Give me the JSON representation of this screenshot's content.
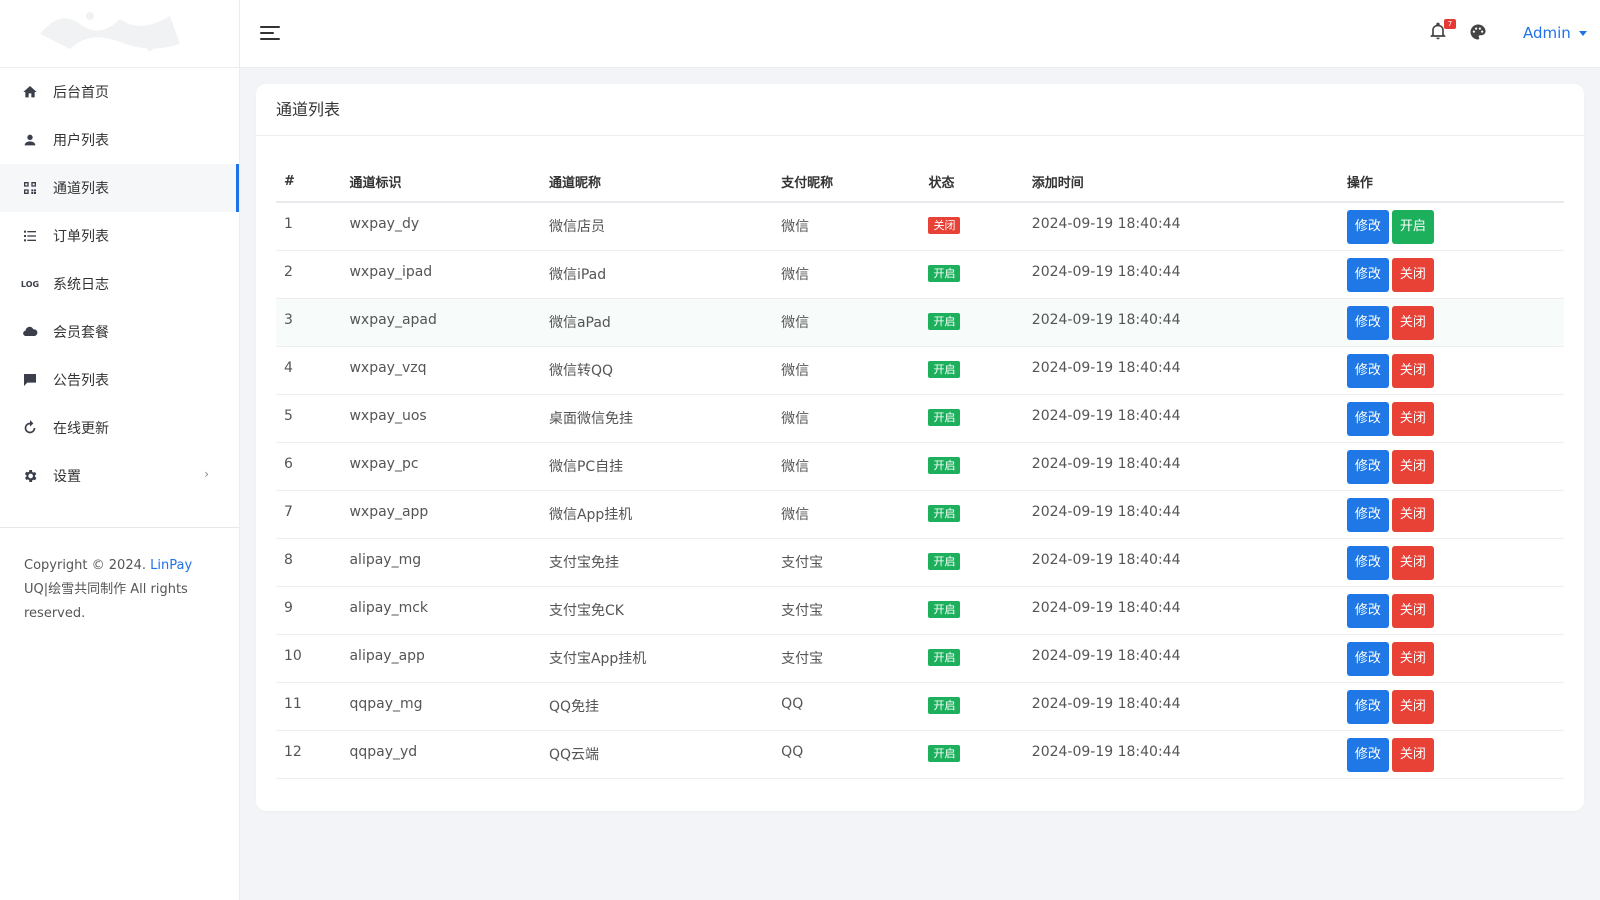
{
  "colors": {
    "accent": "#1f72e8",
    "on": "#1db05c",
    "off": "#e84236"
  },
  "sidebar": {
    "items": [
      {
        "label": "后台首页",
        "icon": "home-icon"
      },
      {
        "label": "用户列表",
        "icon": "user-icon"
      },
      {
        "label": "通道列表",
        "icon": "qrcode-icon",
        "active": true
      },
      {
        "label": "订单列表",
        "icon": "list-icon"
      },
      {
        "label": "系统日志",
        "icon": "log-icon",
        "icon_text": "LOG"
      },
      {
        "label": "会员套餐",
        "icon": "cloud-icon"
      },
      {
        "label": "公告列表",
        "icon": "comment-icon"
      },
      {
        "label": "在线更新",
        "icon": "refresh-icon"
      },
      {
        "label": "设置",
        "icon": "gear-icon",
        "arrow": "›"
      }
    ],
    "footer": {
      "copyright": "Copyright © 2024.",
      "brand": "LinPay",
      "line2": "UQ|绘雪共同制作 All rights",
      "line3": "reserved."
    }
  },
  "topbar": {
    "notification_count": "7",
    "user": "Admin"
  },
  "main": {
    "title": "通道列表",
    "columns": [
      "#",
      "通道标识",
      "通道昵称",
      "支付昵称",
      "状态",
      "添加时间",
      "操作"
    ],
    "edit_label": "修改",
    "rows": [
      {
        "id": "1",
        "code": "wxpay_dy",
        "name": "微信店员",
        "pay": "微信",
        "status": "关闭",
        "time": "2024-09-19 18:40:44",
        "toggle": "开启"
      },
      {
        "id": "2",
        "code": "wxpay_ipad",
        "name": "微信iPad",
        "pay": "微信",
        "status": "开启",
        "time": "2024-09-19 18:40:44",
        "toggle": "关闭"
      },
      {
        "id": "3",
        "code": "wxpay_apad",
        "name": "微信aPad",
        "pay": "微信",
        "status": "开启",
        "time": "2024-09-19 18:40:44",
        "toggle": "关闭"
      },
      {
        "id": "4",
        "code": "wxpay_vzq",
        "name": "微信转QQ",
        "pay": "微信",
        "status": "开启",
        "time": "2024-09-19 18:40:44",
        "toggle": "关闭"
      },
      {
        "id": "5",
        "code": "wxpay_uos",
        "name": "桌面微信免挂",
        "pay": "微信",
        "status": "开启",
        "time": "2024-09-19 18:40:44",
        "toggle": "关闭"
      },
      {
        "id": "6",
        "code": "wxpay_pc",
        "name": "微信PC自挂",
        "pay": "微信",
        "status": "开启",
        "time": "2024-09-19 18:40:44",
        "toggle": "关闭"
      },
      {
        "id": "7",
        "code": "wxpay_app",
        "name": "微信App挂机",
        "pay": "微信",
        "status": "开启",
        "time": "2024-09-19 18:40:44",
        "toggle": "关闭"
      },
      {
        "id": "8",
        "code": "alipay_mg",
        "name": "支付宝免挂",
        "pay": "支付宝",
        "status": "开启",
        "time": "2024-09-19 18:40:44",
        "toggle": "关闭"
      },
      {
        "id": "9",
        "code": "alipay_mck",
        "name": "支付宝免CK",
        "pay": "支付宝",
        "status": "开启",
        "time": "2024-09-19 18:40:44",
        "toggle": "关闭"
      },
      {
        "id": "10",
        "code": "alipay_app",
        "name": "支付宝App挂机",
        "pay": "支付宝",
        "status": "开启",
        "time": "2024-09-19 18:40:44",
        "toggle": "关闭"
      },
      {
        "id": "11",
        "code": "qqpay_mg",
        "name": "QQ免挂",
        "pay": "QQ",
        "status": "开启",
        "time": "2024-09-19 18:40:44",
        "toggle": "关闭"
      },
      {
        "id": "12",
        "code": "qqpay_yd",
        "name": "QQ云端",
        "pay": "QQ",
        "status": "开启",
        "time": "2024-09-19 18:40:44",
        "toggle": "关闭"
      }
    ]
  }
}
